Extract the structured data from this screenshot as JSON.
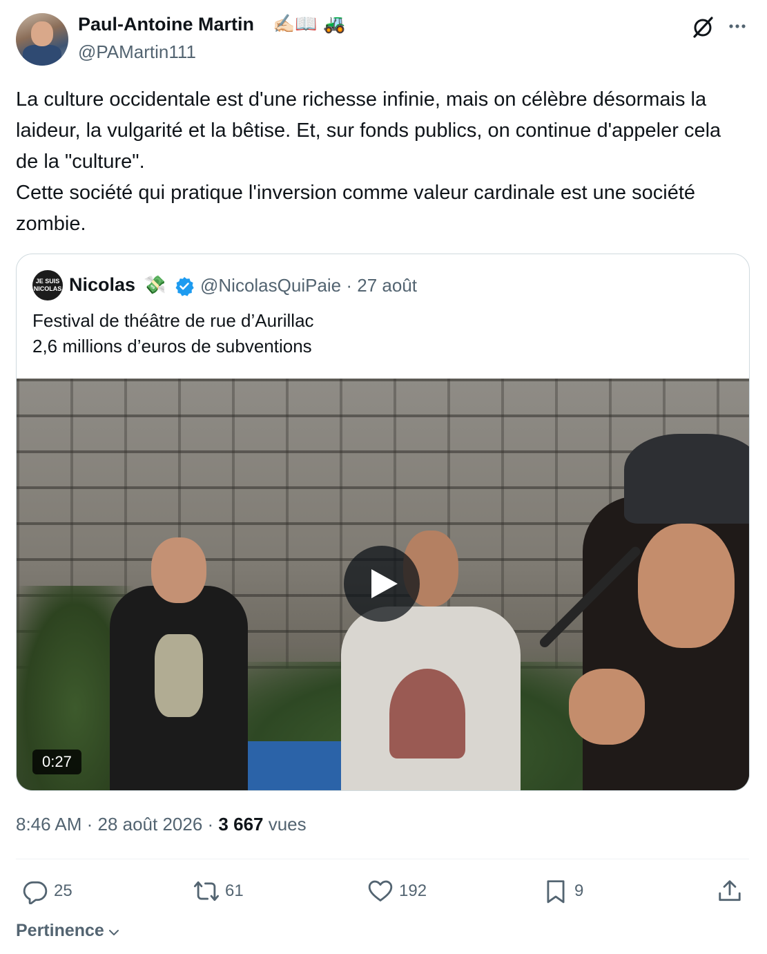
{
  "author": {
    "name": "Paul-Antoine Martin",
    "emoji": "✍🏻📖 🚜",
    "handle": "@PAMartin111"
  },
  "tweet": {
    "lines": [
      "La culture occidentale est d'une richesse infinie, mais on célèbre désormais la laideur, la vulgarité et la bêtise. Et, sur fonds publics, on continue d'appeler cela de la \"culture\".",
      "Cette société qui pratique l'inversion comme valeur cardinale est une société zombie."
    ]
  },
  "quoted": {
    "avatar_text": "JE SUIS NICOLAS",
    "name": "Nicolas",
    "emoji": "💸",
    "handle_date": "@NicolasQuiPaie · 27 août",
    "lines": [
      "Festival de théâtre de rue d’Aurillac",
      "2,6 millions d’euros de subventions"
    ],
    "video_duration": "0:27"
  },
  "meta": {
    "time_date": "8:46 AM · 28 août 2026 · ",
    "views_count": "3 667",
    "views_label": " vues"
  },
  "actions": {
    "replies": "25",
    "reposts": "61",
    "likes": "192",
    "bookmarks": "9"
  },
  "sort": {
    "label": "Pertinence"
  },
  "icons": [
    "grok-icon",
    "more-icon",
    "verified-icon",
    "play-icon",
    "reply-icon",
    "repost-icon",
    "like-icon",
    "bookmark-icon",
    "share-icon",
    "chevron-down-icon"
  ],
  "colors": {
    "text": "#0f1419",
    "secondary": "#536471",
    "verified": "#1d9bf0",
    "border": "#cfd9de"
  }
}
